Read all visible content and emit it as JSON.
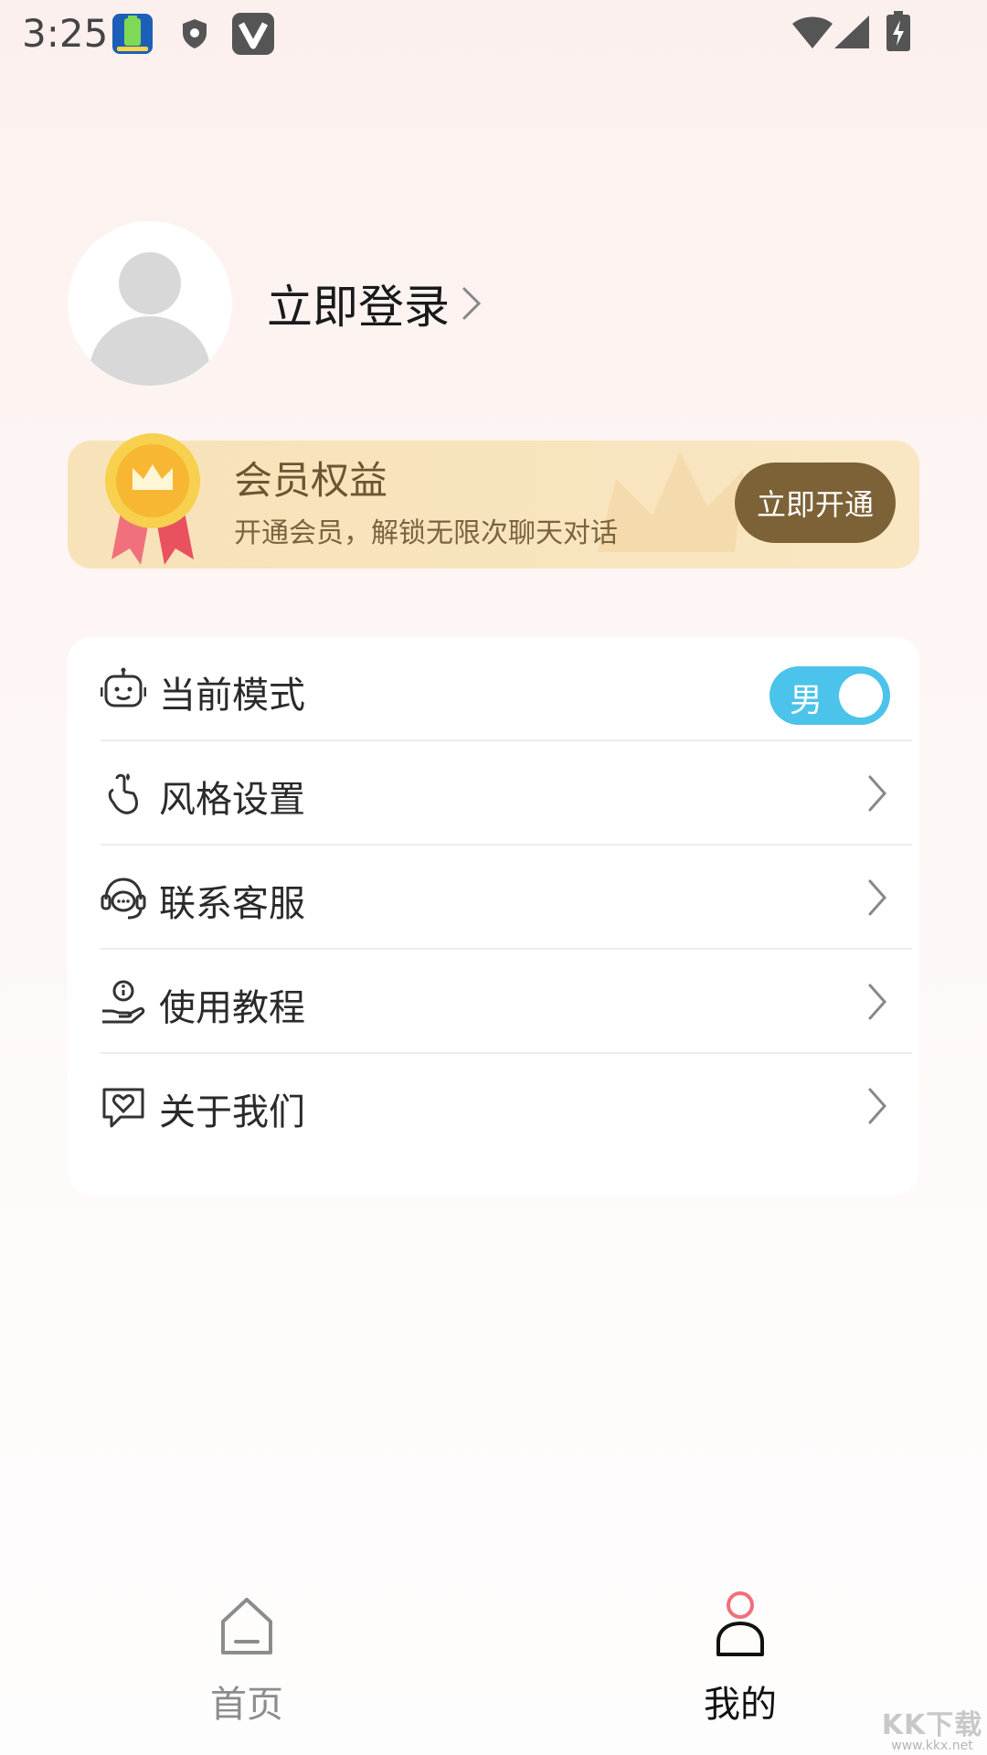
{
  "status_bar": {
    "time": "3:25",
    "icons": [
      "battery-app-icon",
      "shield-icon",
      "v-app-icon",
      "wifi-icon",
      "signal-icon",
      "battery-charging-icon"
    ]
  },
  "profile": {
    "login_label": "立即登录"
  },
  "member": {
    "title": "会员权益",
    "subtitle": "开通会员，解锁无限次聊天对话",
    "button_label": "立即开通",
    "colors": {
      "card": "#f8e4bd",
      "button": "#7c6236"
    }
  },
  "settings": {
    "items": [
      {
        "label": "当前模式",
        "icon": "robot-icon",
        "type": "toggle",
        "toggle_text": "男",
        "toggle_on": true
      },
      {
        "label": "风格设置",
        "icon": "finger-heart-icon",
        "type": "link"
      },
      {
        "label": "联系客服",
        "icon": "headset-icon",
        "type": "link"
      },
      {
        "label": "使用教程",
        "icon": "hand-info-icon",
        "type": "link"
      },
      {
        "label": "关于我们",
        "icon": "chat-heart-icon",
        "type": "link"
      }
    ]
  },
  "bottom_nav": {
    "tabs": [
      {
        "label": "首页",
        "icon": "home-icon",
        "active": false
      },
      {
        "label": "我的",
        "icon": "profile-icon",
        "active": true
      }
    ],
    "colors": {
      "active": "#111111",
      "inactive": "#8c8c8c",
      "accent": "#f0707a"
    }
  },
  "watermark": {
    "big": "KK下载",
    "small": "www.kkx.net"
  }
}
